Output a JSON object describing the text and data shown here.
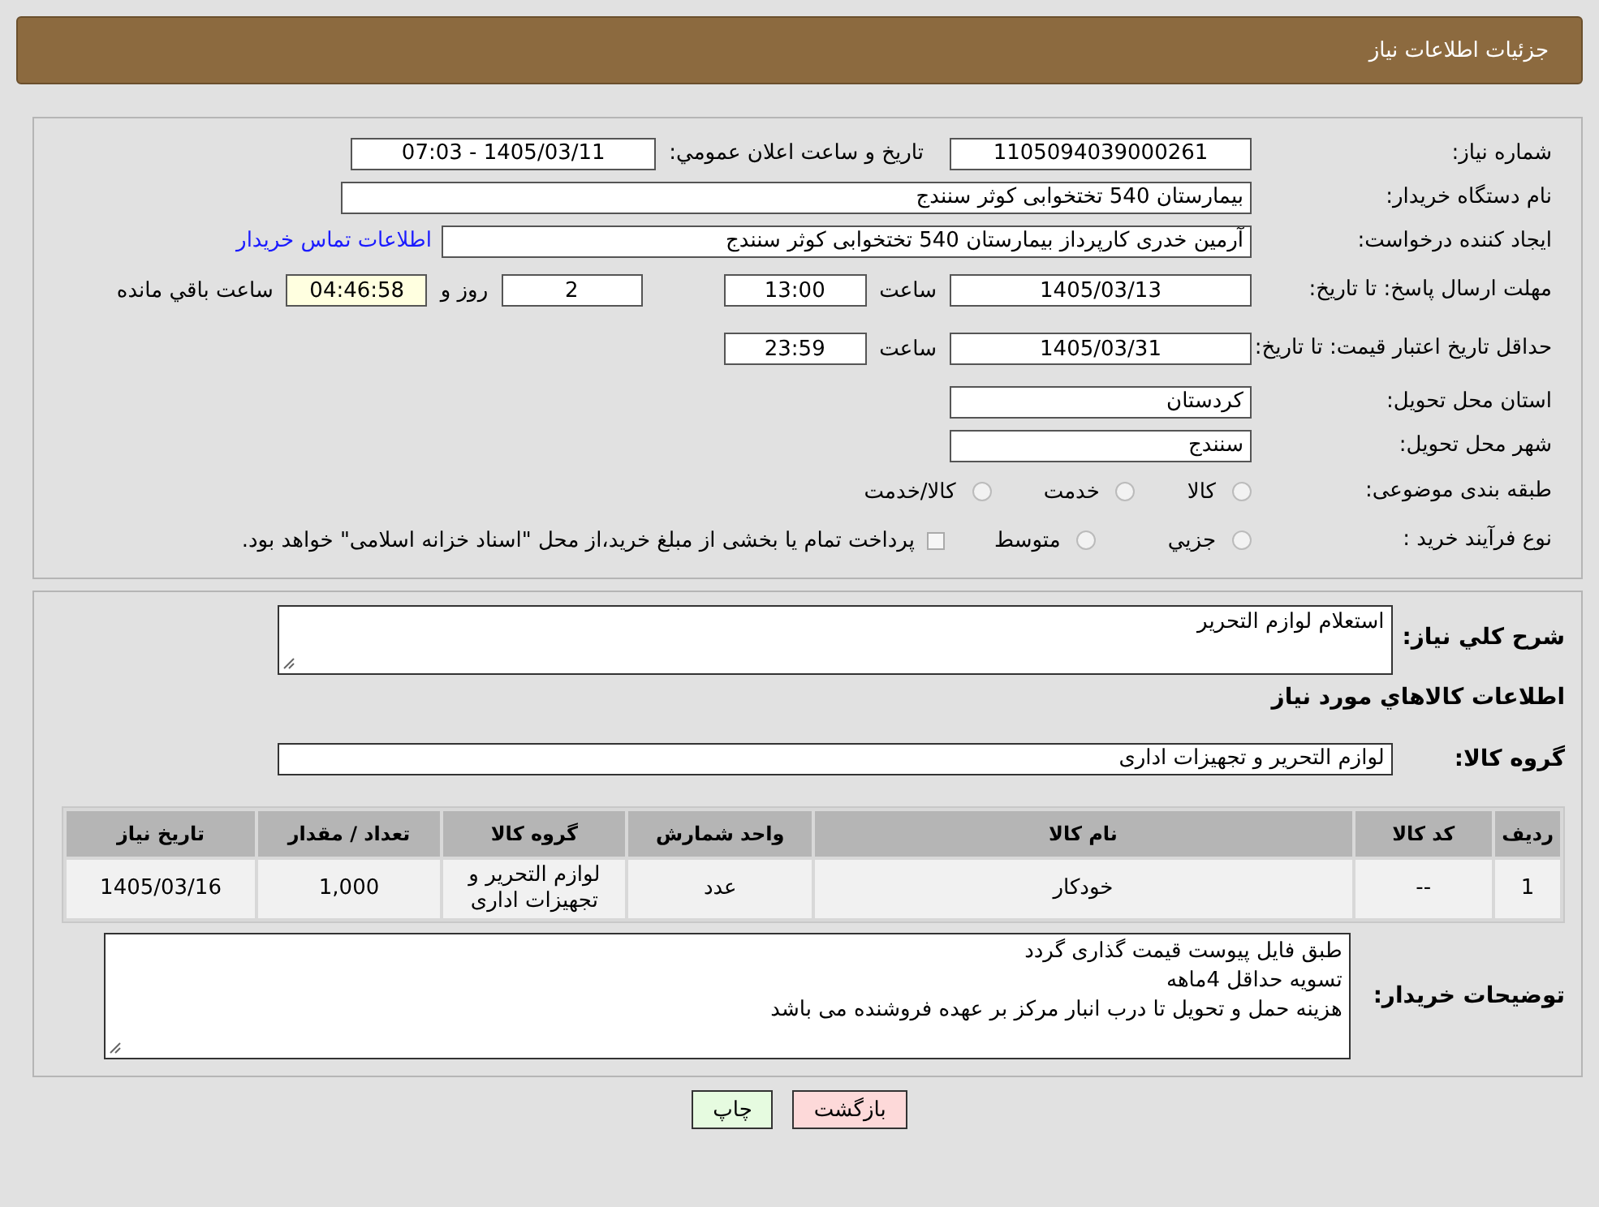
{
  "header": {
    "title": "جزئیات اطلاعات نیاز"
  },
  "info": {
    "need_number": {
      "label": "شماره نیاز:",
      "value": "1105094039000261"
    },
    "announce": {
      "label": "تاریخ و ساعت اعلان عمومي:",
      "value": "1405/03/11 - 07:03"
    },
    "buyer_org": {
      "label": "نام دستگاه خریدار:",
      "value": "بیمارستان 540 تختخوابی کوثر سنندج"
    },
    "requester": {
      "label": "ایجاد کننده درخواست:",
      "value": "آرمین خدری کارپرداز بیمارستان 540 تختخوابی کوثر سنندج",
      "link": "اطلاعات تماس خریدار"
    },
    "reply_deadline": {
      "label": "مهلت ارسال پاسخ: تا تاریخ:",
      "date": "1405/03/13",
      "time_label": "ساعت",
      "time": "13:00",
      "days": "2",
      "days_label": "روز و",
      "remaining": "04:46:58",
      "remaining_label": "ساعت باقي مانده"
    },
    "price_validity": {
      "label": "حداقل تاریخ اعتبار قیمت: تا تاریخ:",
      "date": "1405/03/31",
      "time_label": "ساعت",
      "time": "23:59"
    },
    "province": {
      "label": "استان محل تحویل:",
      "value": "کردستان"
    },
    "city": {
      "label": "شهر محل تحویل:",
      "value": "سنندج"
    },
    "category": {
      "label": "طبقه بندی موضوعی:",
      "options": [
        {
          "label": "کالا",
          "selected": false
        },
        {
          "label": "خدمت",
          "selected": false
        },
        {
          "label": "کالا/خدمت",
          "selected": false
        }
      ]
    },
    "purchase_type": {
      "label": "نوع فرآیند خرید :",
      "options": [
        {
          "label": "جزيي",
          "selected": false
        },
        {
          "label": "متوسط",
          "selected": false
        }
      ],
      "note": {
        "checked": false,
        "text": "پرداخت تمام یا بخشی از مبلغ خرید،از محل \"اسناد خزانه اسلامی\" خواهد بود."
      }
    }
  },
  "details": {
    "description": {
      "label": "شرح کلي نیاز:",
      "value": "استعلام لوازم التحریر"
    },
    "items_heading": "اطلاعات کالاهاي مورد نیاز",
    "goods_group": {
      "label": "گروه کالا:",
      "value": "لوازم التحریر و تجهیزات اداری"
    },
    "table": {
      "columns": [
        "ردیف",
        "کد کالا",
        "نام کالا",
        "واحد شمارش",
        "گروه کالا",
        "تعداد / مقدار",
        "تاریخ نیاز"
      ],
      "rows": [
        [
          "1",
          "--",
          "خودکار",
          "عدد",
          "لوازم التحریر و تجهیزات اداری",
          "1,000",
          "1405/03/16"
        ]
      ]
    },
    "buyer_notes": {
      "label": "توضیحات خریدار:",
      "lines": [
        "طبق فایل پیوست قیمت گذاری گردد",
        "تسویه حداقل 4ماهه",
        "هزینه حمل و تحویل تا درب انبار مرکز بر عهده فروشنده می باشد"
      ]
    }
  },
  "buttons": [
    {
      "kind": "back",
      "label": "بازگشت"
    },
    {
      "kind": "print",
      "label": "چاپ"
    }
  ]
}
